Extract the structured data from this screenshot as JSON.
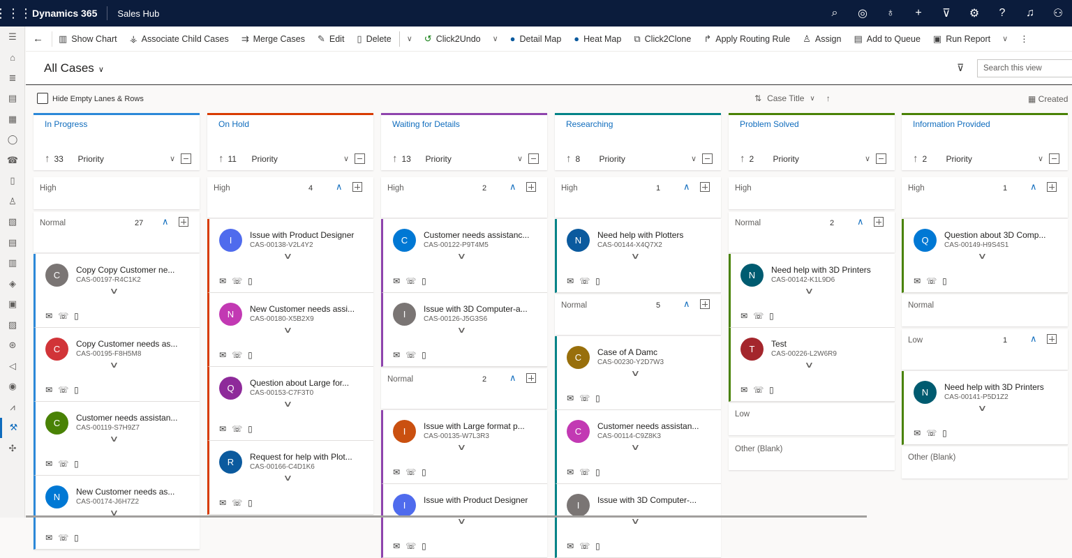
{
  "topbar": {
    "brand": "Dynamics 365",
    "app": "Sales Hub",
    "icons": [
      "search-icon",
      "task-icon",
      "lightbulb-icon",
      "plus-icon",
      "filter-icon",
      "gear-icon",
      "help-icon",
      "bell-icon",
      "person-icon"
    ]
  },
  "leftnav": {
    "icons": [
      "menu-icon",
      "home-icon",
      "recent-icon",
      "pinned-icon",
      "calendar-icon",
      "contact-icon",
      "phone-icon",
      "notebook-icon",
      "user-icon",
      "document-icon",
      "report-icon",
      "list-icon",
      "box-icon",
      "building-icon",
      "clipboard-icon",
      "tag-icon",
      "megaphone-icon",
      "target-icon",
      "chart-icon",
      "wrench-icon",
      "puzzle-icon"
    ]
  },
  "commands": [
    {
      "label": "Show Chart",
      "icon": "chart-icon"
    },
    {
      "label": "Associate Child Cases",
      "icon": "hierarchy-icon"
    },
    {
      "label": "Merge Cases",
      "icon": "merge-icon"
    },
    {
      "label": "Edit",
      "icon": "pencil-icon"
    },
    {
      "label": "Delete",
      "icon": "trash-icon"
    },
    {
      "label": "Click2Undo",
      "icon": "undo-icon"
    },
    {
      "label": "Detail Map",
      "icon": "globe-icon"
    },
    {
      "label": "Heat Map",
      "icon": "globe-icon"
    },
    {
      "label": "Click2Clone",
      "icon": "clone-icon"
    },
    {
      "label": "Apply Routing Rule",
      "icon": "routing-icon"
    },
    {
      "label": "Assign",
      "icon": "assign-icon"
    },
    {
      "label": "Add to Queue",
      "icon": "queue-icon"
    },
    {
      "label": "Run Report",
      "icon": "report-icon"
    }
  ],
  "view": {
    "title": "All Cases",
    "search_placeholder": "Search this view"
  },
  "options": {
    "hide_empty": "Hide Empty Lanes & Rows",
    "sort_field": "Case Title",
    "created": "Created"
  },
  "lanes": [
    {
      "title": "In Progress",
      "count": "33",
      "field": "Priority",
      "color": "#2b88d8",
      "groups": [
        {
          "label": "High",
          "count": "",
          "cards": []
        },
        {
          "label": "Normal",
          "count": "27",
          "cards": [
            {
              "initial": "C",
              "title": "Copy Copy Customer ne...",
              "number": "CAS-00197-R4C1K2",
              "color": "#7a7574"
            },
            {
              "initial": "C",
              "title": "Copy Customer needs as...",
              "number": "CAS-00195-F8H5M8",
              "color": "#d13438"
            },
            {
              "initial": "C",
              "title": "Customer needs assistan...",
              "number": "CAS-00119-S7H9Z7",
              "color": "#498205"
            },
            {
              "initial": "N",
              "title": "New Customer needs as...",
              "number": "CAS-00174-J6H7Z2",
              "color": "#0078d4"
            }
          ]
        }
      ]
    },
    {
      "title": "On Hold",
      "count": "11",
      "field": "Priority",
      "color": "#d83b01",
      "groups": [
        {
          "label": "High",
          "count": "4",
          "cards": [
            {
              "initial": "I",
              "title": "Issue with Product Designer",
              "number": "CAS-00138-V2L4Y2",
              "color": "#4f6bed"
            },
            {
              "initial": "N",
              "title": "New Customer needs assi...",
              "number": "CAS-00180-X5B2X9",
              "color": "#c239b3"
            },
            {
              "initial": "Q",
              "title": "Question about Large for...",
              "number": "CAS-00153-C7F3T0",
              "color": "#8e2a9a"
            },
            {
              "initial": "R",
              "title": "Request for help with Plot...",
              "number": "CAS-00166-C4D1K6",
              "color": "#0b5a9e"
            }
          ]
        }
      ]
    },
    {
      "title": "Waiting for Details",
      "count": "13",
      "field": "Priority",
      "color": "#8e44ad",
      "groups": [
        {
          "label": "High",
          "count": "2",
          "cards": [
            {
              "initial": "C",
              "title": "Customer needs assistanc...",
              "number": "CAS-00122-P9T4M5",
              "color": "#0078d4"
            },
            {
              "initial": "I",
              "title": "Issue with 3D Computer-a...",
              "number": "CAS-00126-J5G3S6",
              "color": "#7a7574"
            }
          ]
        },
        {
          "label": "Normal",
          "count": "2",
          "cards": [
            {
              "initial": "I",
              "title": "Issue with Large format p...",
              "number": "CAS-00135-W7L3R3",
              "color": "#ca5010"
            },
            {
              "initial": "I",
              "title": "Issue with Product Designer",
              "number": "",
              "color": "#4f6bed"
            }
          ]
        }
      ]
    },
    {
      "title": "Researching",
      "count": "8",
      "field": "Priority",
      "color": "#038387",
      "groups": [
        {
          "label": "High",
          "count": "1",
          "cards": [
            {
              "initial": "N",
              "title": "Need help with Plotters",
              "number": "CAS-00144-X4Q7X2",
              "color": "#0b5a9e"
            }
          ]
        },
        {
          "label": "Normal",
          "count": "5",
          "cards": [
            {
              "initial": "C",
              "title": "Case of A Damc",
              "number": "CAS-00230-Y2D7W3",
              "color": "#986f0b"
            },
            {
              "initial": "C",
              "title": "Customer needs assistan...",
              "number": "CAS-00114-C9Z8K3",
              "color": "#c239b3"
            },
            {
              "initial": "I",
              "title": "Issue with 3D Computer-...",
              "number": "",
              "color": "#7a7574"
            }
          ]
        }
      ]
    },
    {
      "title": "Problem Solved",
      "count": "2",
      "field": "Priority",
      "color": "#498205",
      "groups": [
        {
          "label": "High",
          "count": "",
          "cards": []
        },
        {
          "label": "Normal",
          "count": "2",
          "cards": [
            {
              "initial": "N",
              "title": "Need help with 3D Printers",
              "number": "CAS-00142-K1L9D6",
              "color": "#005b70"
            },
            {
              "initial": "T",
              "title": "Test",
              "number": "CAS-00226-L2W6R9",
              "color": "#a4262c"
            }
          ]
        },
        {
          "label": "Low",
          "count": "",
          "cards": []
        },
        {
          "label": "Other (Blank)",
          "count": "",
          "cards": []
        }
      ]
    },
    {
      "title": "Information Provided",
      "count": "2",
      "field": "Priority",
      "color": "#498205",
      "groups": [
        {
          "label": "High",
          "count": "1",
          "cards": [
            {
              "initial": "Q",
              "title": "Question about 3D Comp...",
              "number": "CAS-00149-H9S4S1",
              "color": "#0078d4"
            }
          ]
        },
        {
          "label": "Normal",
          "count": "",
          "cards": []
        },
        {
          "label": "Low",
          "count": "1",
          "cards": [
            {
              "initial": "N",
              "title": "Need help with 3D Printers",
              "number": "CAS-00141-P5D1Z2",
              "color": "#005b70"
            }
          ]
        },
        {
          "label": "Other (Blank)",
          "count": "",
          "cards": []
        }
      ]
    }
  ]
}
